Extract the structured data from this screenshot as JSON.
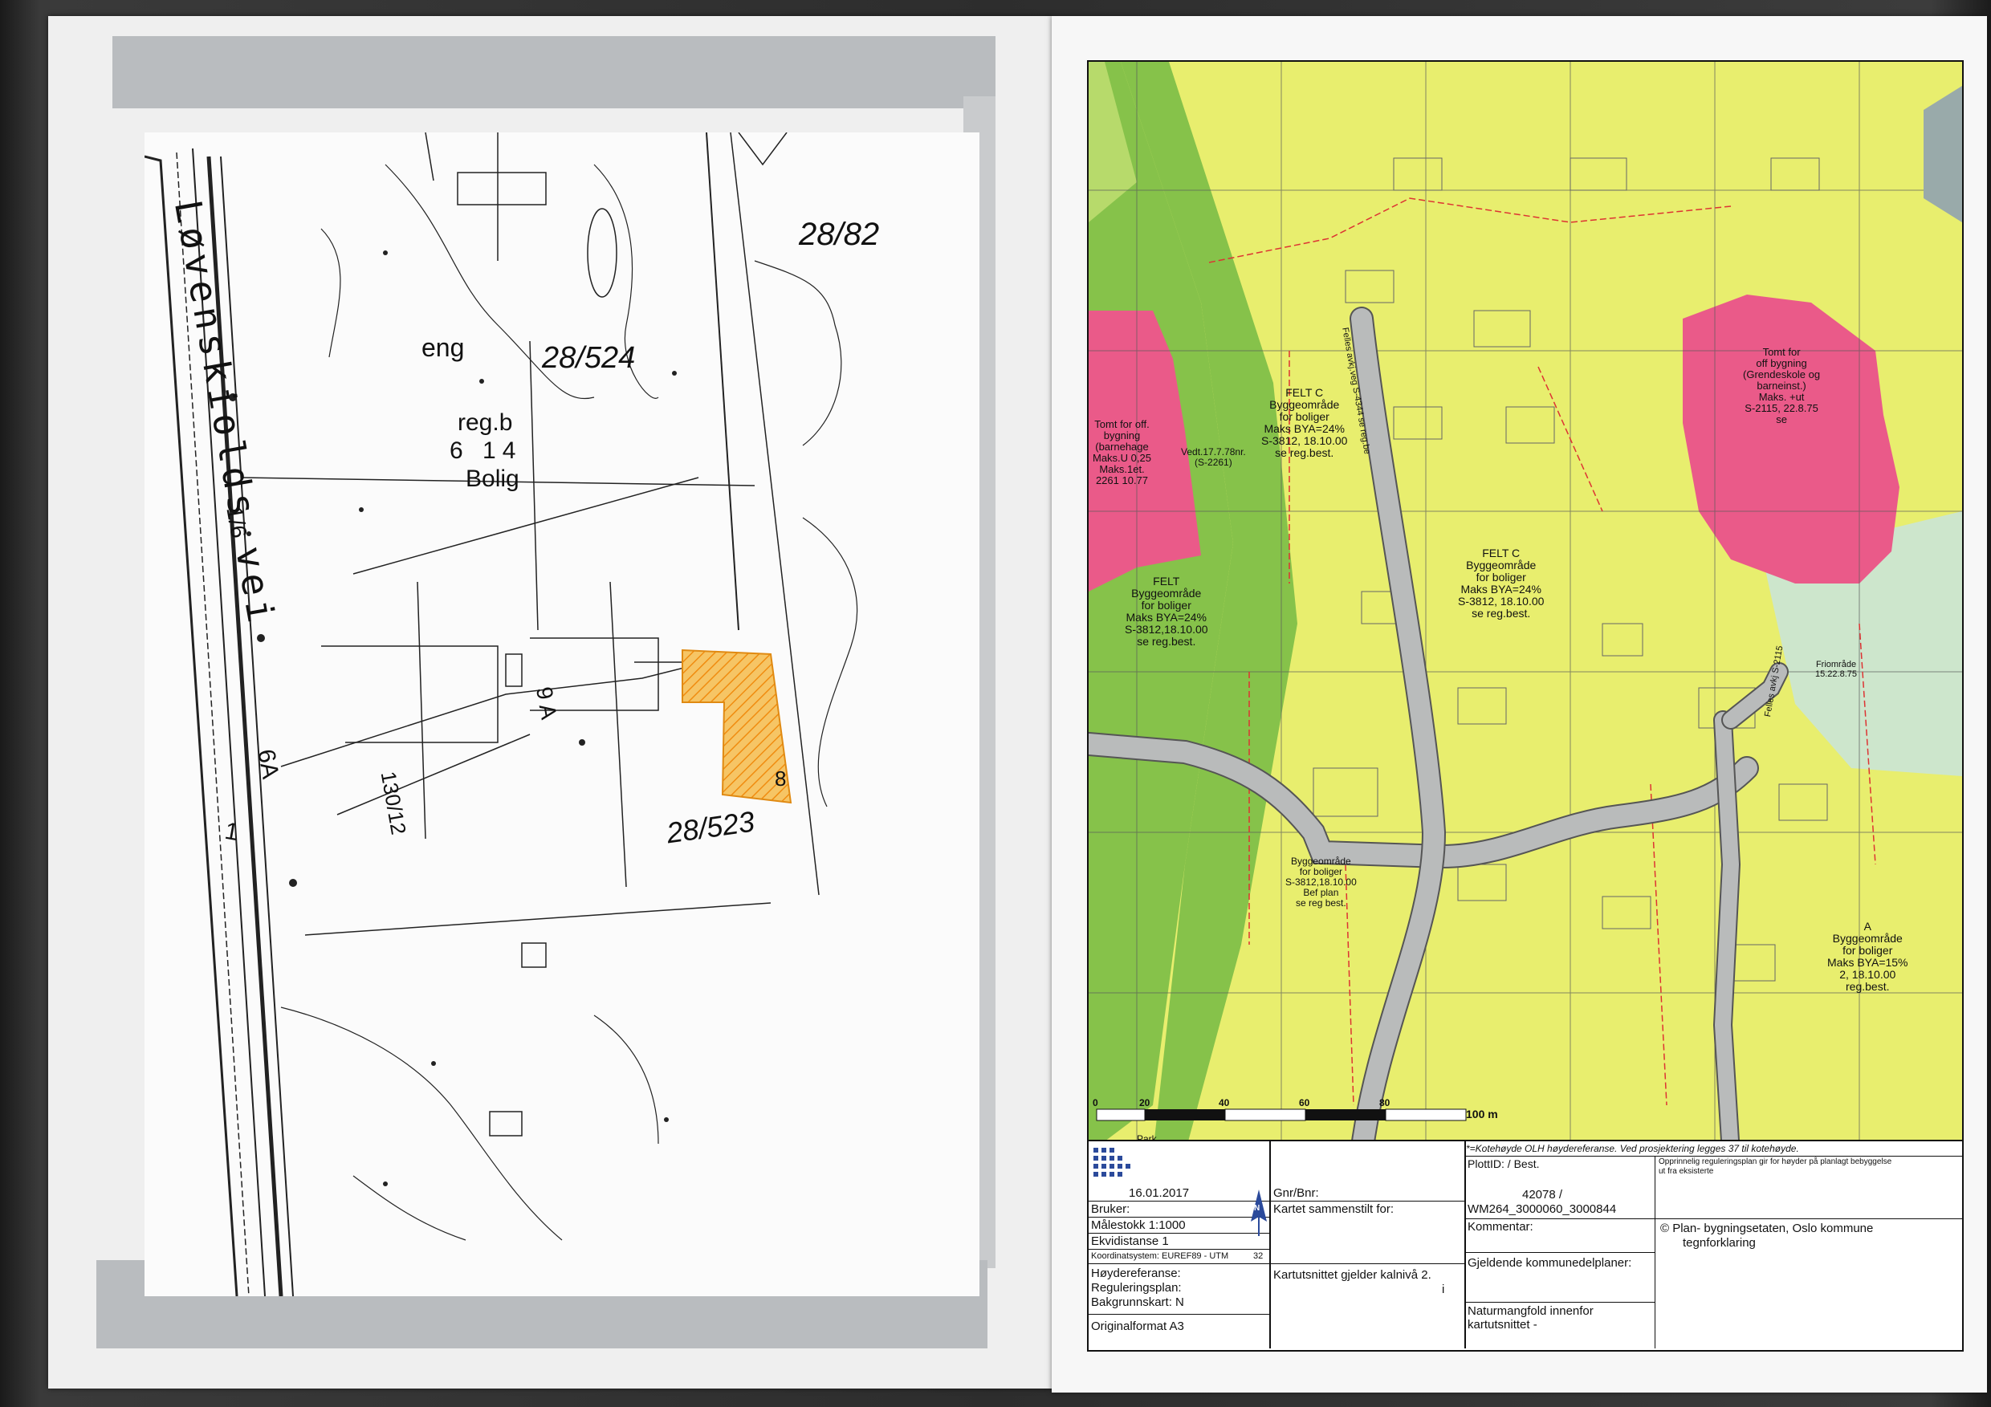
{
  "left_map": {
    "road_name": "Løvenskiolds vei",
    "parcel_labels": [
      "28/82",
      "28/524",
      "28/523",
      "1/6",
      "6A",
      "1"
    ],
    "building_labels": [
      "eng",
      "reg.b",
      "6 14",
      "Bolig",
      "9 A",
      "8"
    ],
    "road_number": "130/12",
    "colors": {
      "highlight": "#f2a92b"
    }
  },
  "right_map": {
    "felt_labels": [
      {
        "lines": [
          "FELT C",
          "Byggeområde",
          "for boliger",
          "Maks BYA=24%",
          "S-3812, 18.10.00",
          "se reg.best."
        ]
      },
      {
        "lines": [
          "FELT C",
          "Byggeområde",
          "for boliger",
          "Maks BYA=24%",
          "S-3812, 18.10.00",
          "se reg.best."
        ]
      },
      {
        "lines": [
          "FELT",
          "Byggeområde",
          "for boliger",
          "Maks BYA=24%",
          "S-3812,18.10.00",
          "se reg.best."
        ]
      },
      {
        "lines": [
          "Byggeområde",
          "for boliger",
          "S-3812,18.10.00",
          "Bef plan",
          "se reg best."
        ]
      },
      {
        "lines": [
          "A",
          "Byggeområde",
          "for boliger",
          "Maks BYA=15%",
          "2, 18.10.00",
          "reg.best."
        ]
      }
    ],
    "pink_labels": [
      {
        "lines": [
          "Tomt for off.",
          "bygning",
          "(barnehage",
          "Maks.U 0,25",
          "Maks.1et.",
          "2261   10.77"
        ]
      },
      {
        "lines": [
          "Tomt for",
          "off bygning",
          "(Grendeskole og",
          "barneinst.)",
          "Maks.     +ut",
          "S-2115, 22.8.75",
          "se"
        ]
      }
    ],
    "vedt_label": [
      "Vedt.17.7.78nr.",
      "(S-2261)"
    ],
    "road_labels": [
      "Felles avkj.veg S-4344 se reg.be",
      "Felles avkj S-2115"
    ],
    "friomrade_label": [
      "Friområde",
      "15.22.8.75"
    ],
    "scale_bar": {
      "ticks": [
        "0",
        "20",
        "40",
        "60",
        "80",
        "100 m"
      ],
      "label_park": "Park"
    },
    "colors": {
      "yellow": "#e8ee6e",
      "green": "#86c24a",
      "light_green": "#b7da6b",
      "pink": "#ea5a89",
      "mint": "#cde6cc",
      "road": "#b9bbbb"
    }
  },
  "title_block": {
    "kotehoyde_note": "*=Kotehøyde   OLH   høydereferanse. Ved prosjektering legges 37   til   kotehøyde.",
    "plottid": "PlottID: / Best.",
    "regplan_note_1": "Opprinnelig reguleringsplan gir    for høyder på planlagt bebyggelse",
    "regplan_note_2": "ut fra                          eksisterte",
    "date": "16.01.2017",
    "bruker": "Bruker:",
    "malestokk": "Målestokk 1:1000",
    "ekvidistanse": "Ekvidistanse 1",
    "koordinatsystem": "Koordinatsystem: EUREF89 - UTM",
    "sone": "32",
    "hoydereferanse": "Høydereferanse:",
    "reguleringsplan": "Reguleringsplan:",
    "bakgrunnskart": "Bakgrunnskart: N",
    "originalformat": "Originalformat A3",
    "gnr_bnr": "Gnr/Bnr:",
    "kartet": "Kartet    sammenstilt for:",
    "id_1": "42078 /",
    "id_2": "WM264_3000060_3000844",
    "kommentar": "Kommentar:",
    "copyright_1": "© Plan-     bygningsetaten, Oslo kommune",
    "copyright_2": "tegnforklaring",
    "kartutsnittet": "Kartutsnittet gjelder      kalnivå 2.",
    "kartutsnittet_2": "i",
    "gjeldende": "Gjeldende kommunedelplaner:",
    "naturmangfold_1": "Naturmangfold innenfor",
    "naturmangfold_2": "kartutsnittet -",
    "north": "N"
  }
}
